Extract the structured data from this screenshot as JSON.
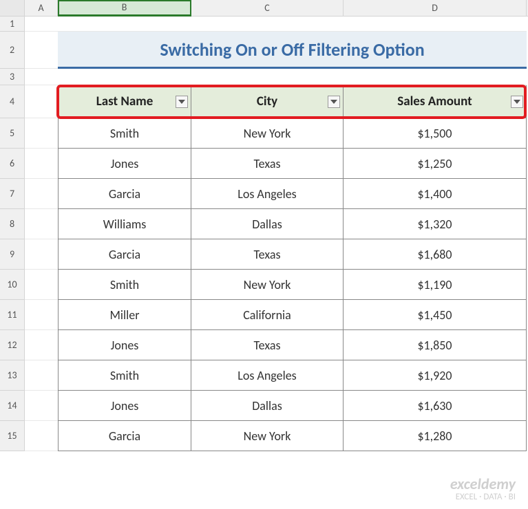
{
  "columns": [
    "A",
    "B",
    "C",
    "D"
  ],
  "rows": [
    "1",
    "2",
    "3",
    "4",
    "5",
    "6",
    "7",
    "8",
    "9",
    "10",
    "11",
    "12",
    "13",
    "14",
    "15"
  ],
  "title": "Switching On or Off Filtering Option",
  "headers": {
    "b": "Last Name",
    "c": "City",
    "d": "Sales Amount"
  },
  "data": [
    {
      "last": "Smith",
      "city": "New York",
      "amount": "$1,500"
    },
    {
      "last": "Jones",
      "city": "Texas",
      "amount": "$1,250"
    },
    {
      "last": "Garcia",
      "city": "Los Angeles",
      "amount": "$1,400"
    },
    {
      "last": "Williams",
      "city": "Dallas",
      "amount": "$1,320"
    },
    {
      "last": "Garcia",
      "city": "Texas",
      "amount": "$1,680"
    },
    {
      "last": "Smith",
      "city": "New York",
      "amount": "$1,190"
    },
    {
      "last": "Miller",
      "city": "California",
      "amount": "$1,450"
    },
    {
      "last": "Jones",
      "city": "Texas",
      "amount": "$1,850"
    },
    {
      "last": "Smith",
      "city": "Los Angeles",
      "amount": "$1,920"
    },
    {
      "last": "Jones",
      "city": "Dallas",
      "amount": "$1,630"
    },
    {
      "last": "Garcia",
      "city": "New York",
      "amount": "$1,280"
    }
  ],
  "watermark": {
    "logo": "exceldemy",
    "tagline": "EXCEL · DATA · BI"
  }
}
